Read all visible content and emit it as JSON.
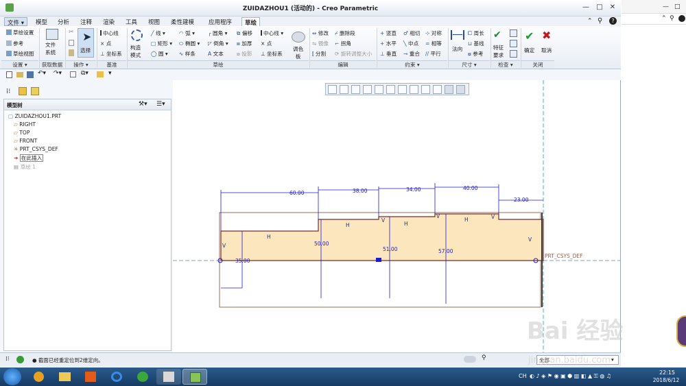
{
  "window": {
    "title": "ZUIDAZHOU1 (活动的) - Creo Parametric",
    "min_label": "—",
    "max_label": "□",
    "close_label": "✕"
  },
  "menu": {
    "file": "文件",
    "tabs": [
      "模型",
      "分析",
      "注释",
      "渲染",
      "工具",
      "视图",
      "柔性建模",
      "应用程序",
      "草绘"
    ],
    "active_tab": "草绘"
  },
  "ribbon": {
    "setup": {
      "sketch_setup": "草绘设置",
      "ref": "参考",
      "sketch_view": "草绘视图",
      "group": "设置"
    },
    "get_data": {
      "file_system": "文件\n系统",
      "group": "获取数据"
    },
    "ops": {
      "select": "选择",
      "group": "操作"
    },
    "datum": {
      "centerline": "中心线",
      "point": "点",
      "csys": "坐标系",
      "group": "基准"
    },
    "sketch": {
      "construction": "构造\n模式",
      "line": "线",
      "rect": "矩形",
      "circle": "圆",
      "arc": "弧",
      "ellipse": "椭圆",
      "spline": "样条",
      "fillet": "圆角",
      "chamfer": "倒角",
      "text": "文本",
      "offset": "偏移",
      "thicken": "加厚",
      "project": "投影",
      "centerline2": "中心线",
      "point2": "点",
      "csys2": "坐标系",
      "palette": "调色\n板",
      "group": "草绘"
    },
    "edit": {
      "modify": "修改",
      "mirror": "镜像",
      "divide": "分割",
      "delete_seg": "删除段",
      "corner": "拐角",
      "rotate_resize": "旋转调整大小",
      "group": "编辑"
    },
    "constrain": {
      "vertical": "竖直",
      "horizontal": "水平",
      "perpendicular": "垂直",
      "tangent": "相切",
      "midpoint": "中点",
      "coincident": "重合",
      "symmetric": "对称",
      "equal": "相等",
      "parallel": "平行",
      "group": "约束"
    },
    "dimension": {
      "normal": "法向",
      "perimeter": "周长",
      "baseline": "基线",
      "reference": "参考",
      "group": "尺寸"
    },
    "inspect": {
      "feature_req": "特征\n要求",
      "group": "检查"
    },
    "close": {
      "ok": "确定",
      "cancel": "取消",
      "group": "关闭"
    }
  },
  "tree": {
    "header": "模型树",
    "items": [
      {
        "label": "ZUIDAZHOU1.PRT",
        "icon": "part-icon"
      },
      {
        "label": "RIGHT",
        "icon": "datum-plane-icon"
      },
      {
        "label": "TOP",
        "icon": "datum-plane-icon"
      },
      {
        "label": "FRONT",
        "icon": "datum-plane-icon"
      },
      {
        "label": "PRT_CSYS_DEF",
        "icon": "csys-icon"
      },
      {
        "label": "在此插入",
        "icon": "insert-arrow-icon"
      },
      {
        "label": "草绘 1",
        "icon": "sketch-icon"
      }
    ]
  },
  "sketch": {
    "dims_horizontal": [
      "60.00",
      "38.00",
      "34.00",
      "40.00",
      "23.00"
    ],
    "dims_vertical": [
      "35.00",
      "50.00",
      "51.00",
      "57.00"
    ],
    "constraint_h": "H",
    "constraint_v": "V",
    "csys_label": "PRT_CSYS_DEF",
    "fill_color": "#fbe6bd",
    "line_color": "#1f2f8a",
    "dim_color": "#1a1ad4"
  },
  "status": {
    "message": "截面已经重定位到2维定向。",
    "filter": "全部"
  },
  "taskbar": {
    "time": "22:15",
    "date": "2018/6/12",
    "lang": "CH"
  },
  "watermark": {
    "brand": "Bai 经验",
    "url": "jingyan.baidu.com"
  }
}
